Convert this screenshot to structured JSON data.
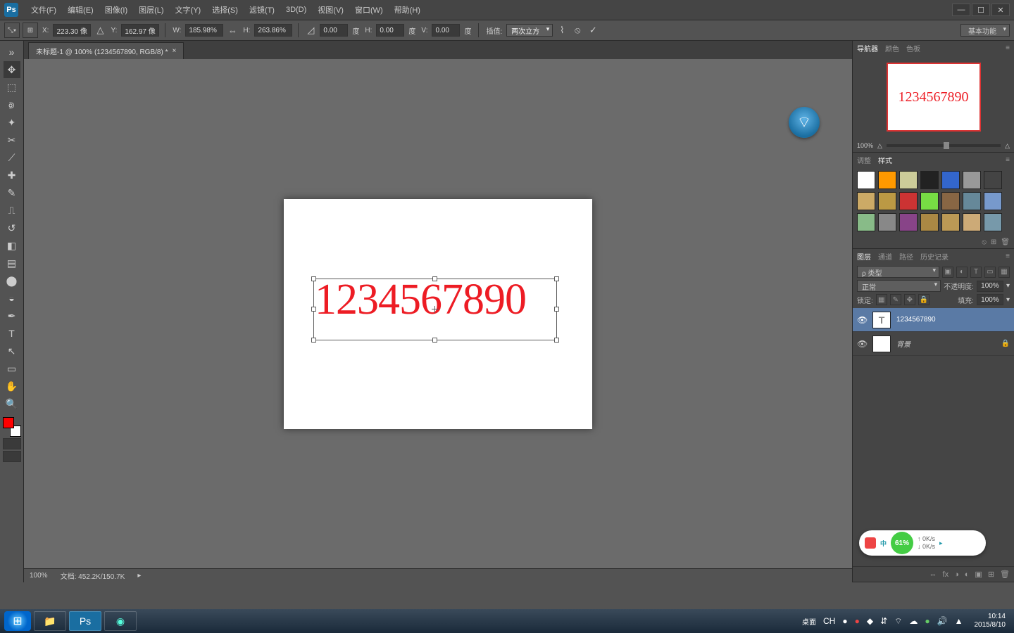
{
  "app": {
    "logo": "Ps"
  },
  "menubar": [
    "文件(F)",
    "编辑(E)",
    "图像(I)",
    "图层(L)",
    "文字(Y)",
    "选择(S)",
    "滤镜(T)",
    "3D(D)",
    "视图(V)",
    "窗口(W)",
    "帮助(H)"
  ],
  "window_buttons": {
    "min": "—",
    "max": "☐",
    "close": "✕"
  },
  "optionsbar": {
    "x_label": "X:",
    "x": "223.30 像",
    "y_label": "Y:",
    "y": "162.97 像",
    "w_label": "W:",
    "w": "185.98%",
    "h_label": "H:",
    "h": "263.86%",
    "angle_label": "△",
    "angle": "0.00",
    "angle_unit": "度",
    "skew_h_label": "H:",
    "skew_h": "0.00",
    "skew_h_unit": "度",
    "skew_v_label": "V:",
    "skew_v": "0.00",
    "skew_v_unit": "度",
    "interp_label": "插值:",
    "interp_value": "两次立方",
    "workspace": "基本功能"
  },
  "document": {
    "tab_title": "未标题-1 @ 100% (1234567890, RGB/8) *",
    "text_content": "1234567890",
    "zoom": "100%",
    "doc_info": "文档: 452.2K/150.7K"
  },
  "panels": {
    "navigator": {
      "tabs": [
        "导航器",
        "颜色",
        "色板"
      ],
      "zoom": "100%",
      "thumb_text": "1234567890"
    },
    "styles": {
      "tabs": [
        "调整",
        "样式"
      ]
    },
    "layers": {
      "tabs": [
        "图层",
        "通道",
        "路径",
        "历史记录"
      ],
      "kind_label": "ρ 类型",
      "blend": "正常",
      "opacity_label": "不透明度:",
      "opacity": "100%",
      "lock_label": "锁定:",
      "fill_label": "填充:",
      "fill": "100%",
      "items": [
        {
          "name": "1234567890",
          "type": "text"
        },
        {
          "name": "背景",
          "type": "bitmap",
          "locked": true
        }
      ]
    }
  },
  "taskbar": {
    "desktop_label": "桌面",
    "ime": "CH",
    "clock_time": "10:14",
    "clock_date": "2015/8/10"
  },
  "widget": {
    "percent": "61%",
    "up": "0K/s",
    "down": "0K/s"
  },
  "style_swatches": [
    "#ffffff",
    "#ff9900",
    "#cccc99",
    "#222222",
    "#3366cc",
    "#999999",
    "#444444",
    "#ccaa66",
    "#bb9944",
    "#cc3333",
    "#77dd44",
    "#886644",
    "#668899",
    "#7799cc",
    "#88bb88",
    "#888888",
    "#884488",
    "#aa8844",
    "#bb9955",
    "#ccaa77",
    "#7799aa"
  ]
}
